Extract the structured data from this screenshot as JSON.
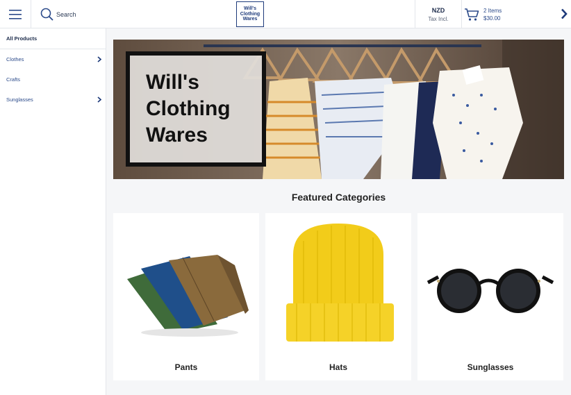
{
  "header": {
    "search_label": "Search",
    "logo_text": "Will's Clothing Wares",
    "currency_code": "NZD",
    "currency_tax": "Tax Incl.",
    "cart_count": "2 Items",
    "cart_total": "$30.00"
  },
  "sidebar": {
    "items": [
      {
        "label": "All Products",
        "has_children": false
      },
      {
        "label": "Clothes",
        "has_children": true
      },
      {
        "label": "Crafts",
        "has_children": false
      },
      {
        "label": "Sunglasses",
        "has_children": true
      }
    ]
  },
  "hero": {
    "title": "Will's\nClothing\nWares"
  },
  "featured": {
    "title": "Featured Categories",
    "cards": [
      {
        "label": "Pants"
      },
      {
        "label": "Hats"
      },
      {
        "label": "Sunglasses"
      }
    ]
  },
  "colors": {
    "brand_navy": "#1d3a7a",
    "link_blue": "#2b4a8a",
    "hat_yellow": "#f2cc1a"
  }
}
